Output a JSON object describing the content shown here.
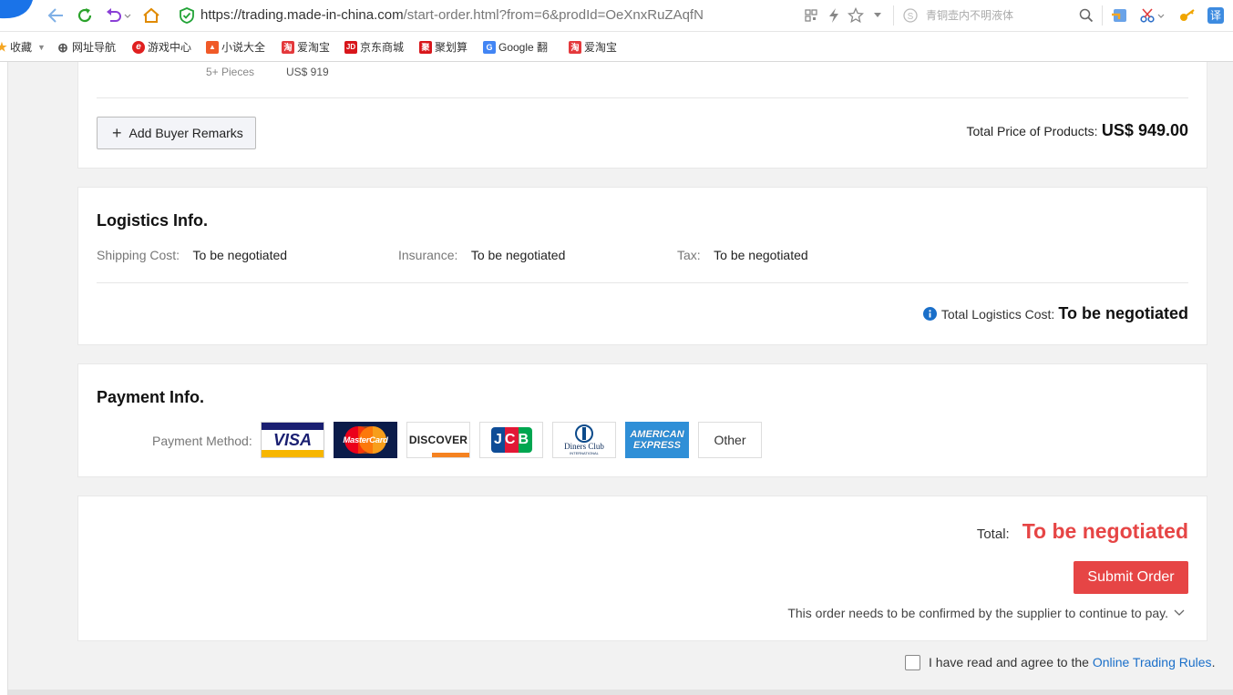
{
  "browser": {
    "url_host": "https://trading.made-in-china.com",
    "url_path": "/start-order.html?from=6&prodId=OeXnxRuZAqfN",
    "search_placeholder": "青铜壶内不明液体",
    "translate_label": "译"
  },
  "bookmarks": [
    {
      "label": "收藏",
      "icon": "star-icon",
      "color": "#f5a623"
    },
    {
      "label": "网址导航",
      "icon": "globe-icon",
      "color": "#555555"
    },
    {
      "label": "游戏中心",
      "icon": "game-icon",
      "color": "#e02020"
    },
    {
      "label": "小说大全",
      "icon": "book-icon",
      "color": "#f05a28"
    },
    {
      "label": "爱淘宝",
      "icon": "taobao-icon",
      "color": "#e4393c"
    },
    {
      "label": "京东商城",
      "icon": "jd-icon",
      "color": "#d8161b"
    },
    {
      "label": "聚划算",
      "icon": "juhuasuan-icon",
      "color": "#d8161b"
    },
    {
      "label": "Google 翻",
      "icon": "google-translate-icon",
      "color": "#4285f4"
    },
    {
      "label": "爱淘宝",
      "icon": "taobao-icon",
      "color": "#e4393c"
    }
  ],
  "bookmark_glyphs": [
    "★",
    "⊕",
    "e",
    "▲",
    "淘",
    "JD",
    "聚",
    "G",
    "淘"
  ],
  "products": {
    "tier_qty": "5+ Pieces",
    "tier_price": "US$ 919",
    "add_remarks_label": "Add Buyer Remarks",
    "total_label": "Total Price of Products:",
    "total_value": "US$ 949.00"
  },
  "logistics": {
    "title": "Logistics Info.",
    "shipping_label": "Shipping Cost:",
    "shipping_value": "To be negotiated",
    "insurance_label": "Insurance:",
    "insurance_value": "To be negotiated",
    "tax_label": "Tax:",
    "tax_value": "To be negotiated",
    "total_label": "Total Logistics Cost:",
    "total_value": "To be negotiated"
  },
  "payment": {
    "title": "Payment Info.",
    "method_label": "Payment Method:",
    "methods": [
      {
        "name": "VISA",
        "icon": "visa-icon"
      },
      {
        "name": "MasterCard",
        "icon": "mastercard-icon"
      },
      {
        "name": "DISCOVER",
        "icon": "discover-icon"
      },
      {
        "name": "JCB",
        "icon": "jcb-icon"
      },
      {
        "name": "Diners Club",
        "sub": "INTERNATIONAL",
        "icon": "diners-club-icon"
      },
      {
        "name": "AMERICAN",
        "sub": "EXPRESS",
        "icon": "amex-icon"
      }
    ],
    "other_label": "Other"
  },
  "summary": {
    "total_label": "Total:",
    "total_value": "To be negotiated",
    "submit_label": "Submit Order",
    "note": "This order needs to be confirmed by the supplier to continue to pay.",
    "agree_text": "I have read and agree to the",
    "agree_link": "Online Trading Rules",
    "agree_end": "."
  },
  "colors": {
    "accent_red": "#e64545",
    "link_blue": "#1a6fc9",
    "info_blue": "#1a6fc9"
  }
}
